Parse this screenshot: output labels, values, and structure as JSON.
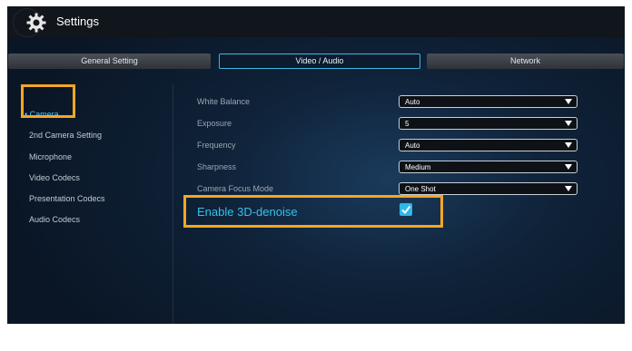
{
  "window": {
    "title": "Settings",
    "icon": "gear-icon"
  },
  "tabs": [
    {
      "label": "General Setting",
      "active": false
    },
    {
      "label": "Video / Audio",
      "active": true
    },
    {
      "label": "Network",
      "active": false
    }
  ],
  "sidebar": {
    "items": [
      {
        "label": "Camera",
        "active": true,
        "bullet": "•"
      },
      {
        "label": "2nd Camera Setting"
      },
      {
        "label": "Microphone"
      },
      {
        "label": "Video Codecs"
      },
      {
        "label": "Presentation Codecs"
      },
      {
        "label": "Audio Codecs"
      }
    ]
  },
  "camera_settings": {
    "rows": [
      {
        "label": "White Balance",
        "value": "Auto"
      },
      {
        "label": "Exposure",
        "value": "5"
      },
      {
        "label": "Frequency",
        "value": "Auto"
      },
      {
        "label": "Sharpness",
        "value": "Medium"
      },
      {
        "label": "Camera Focus Mode",
        "value": "One Shot"
      }
    ],
    "denoise": {
      "label": "Enable 3D-denoise",
      "checked": true
    }
  },
  "colors": {
    "accent": "#33c1ef",
    "highlight": "#f5a623",
    "background": "#0f2238"
  }
}
